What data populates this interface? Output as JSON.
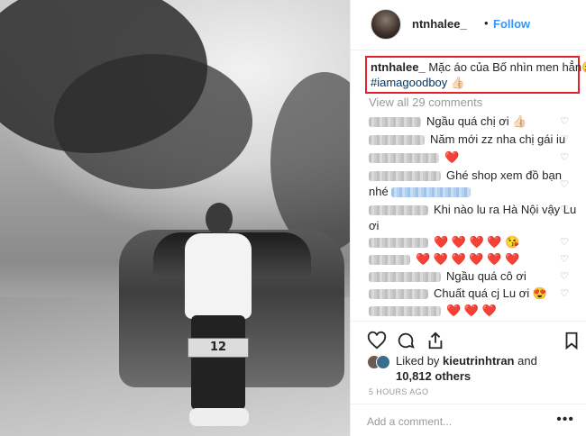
{
  "post": {
    "photo": {
      "plate_text": "12"
    },
    "header": {
      "username": "ntnhalee_",
      "separator": "•",
      "follow_label": "Follow"
    },
    "caption": {
      "username": "ntnhalee_",
      "text": "Mặc áo của Bố nhìn men hẳn🤪",
      "hashtag": "#iamagoodboy",
      "hashtag_emoji": "👍🏻"
    },
    "view_all_label": "View all 29 comments",
    "comments": [
      {
        "text": "Ngầu quá chị ơi 👍🏻"
      },
      {
        "text": "Năm mới zz nha chị gái iu"
      },
      {
        "text": "❤️"
      },
      {
        "text": "Ghé shop xem đồ bạn"
      },
      {
        "text": "nhé"
      },
      {
        "text": "Khi nào lu ra Hà Nội vậy Lu"
      },
      {
        "text": "ơi"
      },
      {
        "text": "❤️ ❤️ ❤️ ❤️ 😘"
      },
      {
        "text": "❤️ ❤️ ❤️ ❤️ ❤️ ❤️"
      },
      {
        "text": "Ngầu quá cô ơi"
      },
      {
        "text": "Chuất quá cj Lu ơi 😍"
      },
      {
        "text": "❤️ ❤️ ❤️"
      }
    ],
    "icons": {
      "like": "heart-icon",
      "comment": "comment-icon",
      "share": "share-icon",
      "save": "bookmark-icon",
      "comment_like": "heart-icon"
    },
    "likes": {
      "prefix": "Liked by ",
      "user": "kieutrinhtran",
      "middle": " and",
      "others": "10,812 others"
    },
    "timestamp": "5 HOURS AGO",
    "add_comment_placeholder": "Add a comment...",
    "more_label": "•••",
    "colors": {
      "link": "#3897f0",
      "hashtag": "#003569",
      "highlight_box": "#e3232b",
      "muted": "#999999"
    }
  }
}
